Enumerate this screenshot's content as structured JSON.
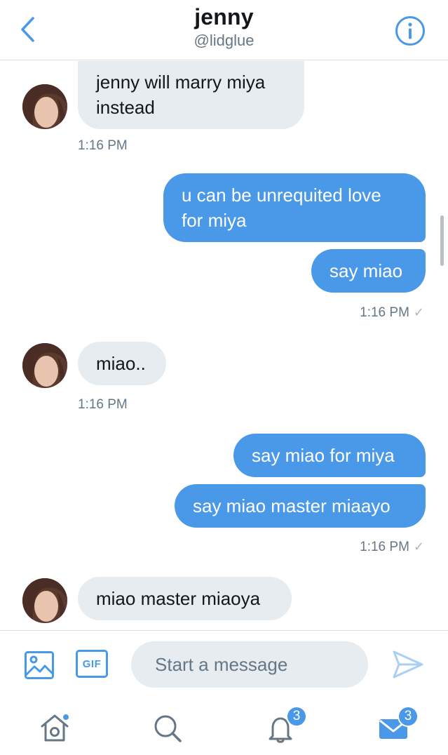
{
  "header": {
    "title": "jenny",
    "handle": "@lidglue"
  },
  "messages": [
    {
      "direction": "incoming",
      "lines": [
        "jenny will marry miya",
        "instead"
      ],
      "time": "1:16 PM"
    },
    {
      "direction": "outgoing",
      "lines": [
        "u can be unrequited love",
        "for miya"
      ]
    },
    {
      "direction": "outgoing",
      "lines": [
        "say miao"
      ],
      "time": "1:16 PM",
      "read_mark": "✓"
    },
    {
      "direction": "incoming",
      "lines": [
        "miao.."
      ],
      "time": "1:16 PM"
    },
    {
      "direction": "outgoing",
      "lines": [
        "say miao for miya"
      ]
    },
    {
      "direction": "outgoing",
      "lines": [
        "say miao master miaayo"
      ],
      "time": "1:16 PM",
      "read_mark": "✓"
    },
    {
      "direction": "incoming",
      "lines": [
        "miao master miaoya"
      ]
    }
  ],
  "composer": {
    "gif_label": "GIF",
    "placeholder": "Start a message"
  },
  "tabbar": {
    "home_icon": "home-icon",
    "search_icon": "search-icon",
    "notifications_badge": "3",
    "messages_badge": "3"
  },
  "colors": {
    "accent": "#4a99e9",
    "incoming_bubble": "#e6ecf0",
    "secondary_text": "#657786"
  }
}
